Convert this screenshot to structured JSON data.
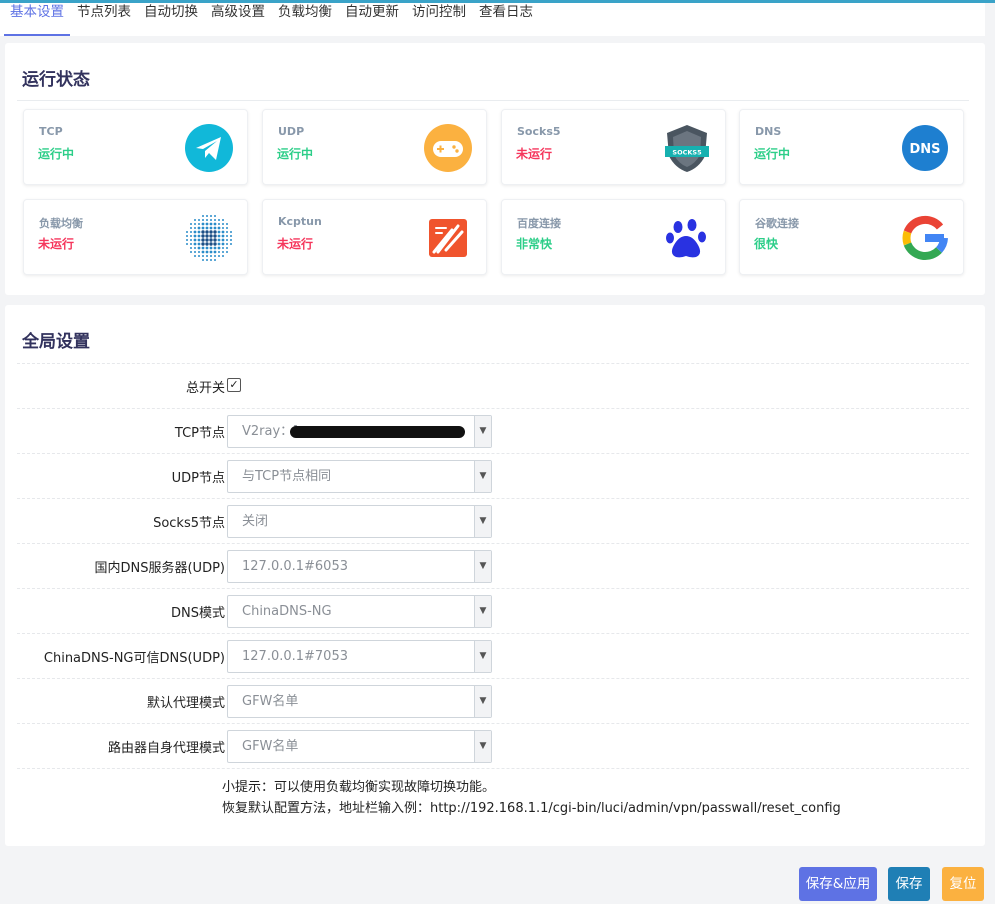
{
  "tabs": [
    "基本设置",
    "节点列表",
    "自动切换",
    "高级设置",
    "负载均衡",
    "自动更新",
    "访问控制",
    "查看日志"
  ],
  "status_section": {
    "title": "运行状态",
    "tiles": [
      {
        "name": "TCP",
        "status": "运行中",
        "state": "ok",
        "icon": "paper-plane-icon"
      },
      {
        "name": "UDP",
        "status": "运行中",
        "state": "ok",
        "icon": "gamepad-icon"
      },
      {
        "name": "Socks5",
        "status": "未运行",
        "state": "bad",
        "icon": "socks5-shield-icon"
      },
      {
        "name": "DNS",
        "status": "运行中",
        "state": "ok",
        "icon": "dns-icon"
      },
      {
        "name": "负载均衡",
        "status": "未运行",
        "state": "bad",
        "icon": "dotted-globe-icon"
      },
      {
        "name": "Kcptun",
        "status": "未运行",
        "state": "bad",
        "icon": "kcptun-icon"
      },
      {
        "name": "百度连接",
        "status": "非常快",
        "state": "ok",
        "icon": "baidu-paw-icon"
      },
      {
        "name": "谷歌连接",
        "status": "很快",
        "state": "ok",
        "icon": "google-g-icon"
      }
    ]
  },
  "global_section": {
    "title": "全局设置",
    "master_switch": {
      "label": "总开关",
      "checked": true
    },
    "fields": [
      {
        "label": "TCP节点",
        "value": "V2ray：[",
        "redacted": true
      },
      {
        "label": "UDP节点",
        "value": "与TCP节点相同"
      },
      {
        "label": "Socks5节点",
        "value": "关闭"
      },
      {
        "label": "国内DNS服务器(UDP)",
        "value": "127.0.0.1#6053"
      },
      {
        "label": "DNS模式",
        "value": "ChinaDNS-NG"
      },
      {
        "label": "ChinaDNS-NG可信DNS(UDP)",
        "value": "127.0.0.1#7053"
      },
      {
        "label": "默认代理模式",
        "value": "GFW名单"
      },
      {
        "label": "路由器自身代理模式",
        "value": "GFW名单"
      }
    ],
    "hint_line1": "小提示：可以使用负载均衡实现故障切换功能。",
    "hint_line2": "恢复默认配置方法，地址栏输入例：http://192.168.1.1/cgi-bin/luci/admin/vpn/passwall/reset_config"
  },
  "buttons": {
    "save_apply": "保存&应用",
    "save": "保存",
    "reset": "复位"
  },
  "colors": {
    "accent": "#5e72e4",
    "ok": "#2dce89",
    "bad": "#f5365c",
    "save": "#1f7fb5",
    "reset": "#fbb140"
  }
}
